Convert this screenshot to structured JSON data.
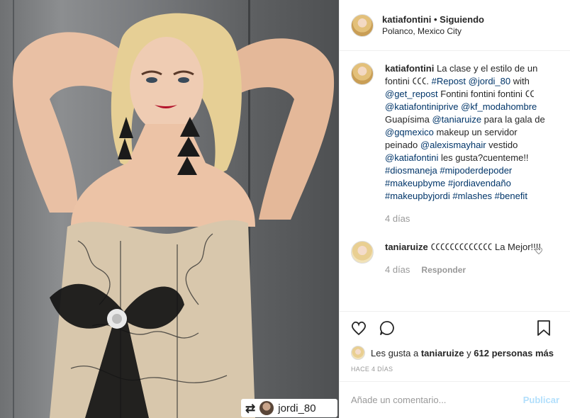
{
  "post": {
    "photo_tag": {
      "icon": "repost-icon",
      "username": "jordi_80"
    }
  },
  "header": {
    "username": "katiafontini",
    "separator": "•",
    "follow_status": "Siguiendo",
    "location": "Polanco, Mexico City"
  },
  "caption": {
    "username": "katiafontini",
    "segments": [
      {
        "t": "La clase y el estilo de un fontini 𑀝𑀝𑀝. "
      },
      {
        "t": "#Repost",
        "link": true
      },
      {
        "t": " "
      },
      {
        "t": "@jordi_80",
        "link": true
      },
      {
        "t": " with "
      },
      {
        "t": "@get_repost",
        "link": true
      },
      {
        "t": " Fontini fontini fontini 𑀝𑀝 "
      },
      {
        "t": "@katiafontiniprive",
        "link": true
      },
      {
        "t": " "
      },
      {
        "t": "@kf_modahombre",
        "link": true
      },
      {
        "t": " Guapísima "
      },
      {
        "t": "@taniaruize",
        "link": true
      },
      {
        "t": " para la gala de "
      },
      {
        "t": "@gqmexico",
        "link": true
      },
      {
        "t": " makeup un servidor peinado "
      },
      {
        "t": "@alexismayhair",
        "link": true
      },
      {
        "t": " vestido "
      },
      {
        "t": "@katiafontini",
        "link": true
      },
      {
        "t": " les gusta?cuenteme!! "
      },
      {
        "t": "#diosmaneja",
        "link": true
      },
      {
        "t": " "
      },
      {
        "t": "#mipoderdepoder",
        "link": true
      },
      {
        "t": " "
      },
      {
        "t": "#makeupbyme",
        "link": true
      },
      {
        "t": " "
      },
      {
        "t": "#jordiavendaño",
        "link": true
      },
      {
        "t": " "
      },
      {
        "t": "#makeupbyjordi",
        "link": true
      },
      {
        "t": " "
      },
      {
        "t": "#mlashes",
        "link": true
      },
      {
        "t": " "
      },
      {
        "t": "#benefit",
        "link": true
      }
    ],
    "time": "4 días"
  },
  "comment": {
    "username": "taniaruize",
    "text": "𑀝𑀝𑀝𑀝𑀝𑀝𑀝𑀝𑀝𑀝𑀝𑀝𑀝 La Mejor!!!!",
    "time": "4 días",
    "reply_label": "Responder"
  },
  "actions": {
    "like": "heart-icon",
    "comment": "comment-icon",
    "save": "bookmark-icon"
  },
  "likes": {
    "prefix": "Les gusta a",
    "user": "taniaruize",
    "middle": "y",
    "others": "612 personas más"
  },
  "timestamp": "HACE 4 DÍAS",
  "add_comment": {
    "placeholder": "Añade un comentario...",
    "publish_label": "Publicar"
  }
}
